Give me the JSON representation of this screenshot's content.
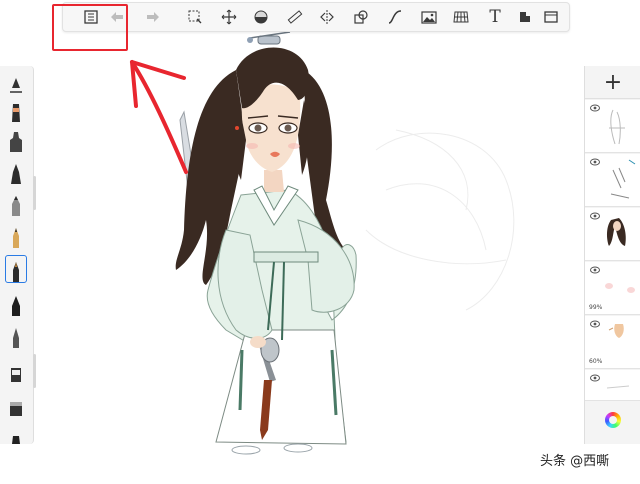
{
  "toolbar": {
    "tools": [
      {
        "name": "gallery-icon"
      },
      {
        "name": "undo-icon"
      },
      {
        "name": "redo-icon"
      },
      {
        "name": "selection-icon"
      },
      {
        "name": "transform-icon"
      },
      {
        "name": "fill-icon"
      },
      {
        "name": "ruler-icon"
      },
      {
        "name": "symmetry-icon"
      },
      {
        "name": "shapes-icon"
      },
      {
        "name": "stroke-icon"
      },
      {
        "name": "import-image-icon"
      },
      {
        "name": "perspective-icon"
      },
      {
        "name": "text-icon",
        "glyph": "T"
      },
      {
        "name": "flipbook-icon"
      },
      {
        "name": "fullscreen-icon"
      }
    ]
  },
  "brushes": [
    {
      "name": "brush-settings-icon"
    },
    {
      "name": "airbrush-icon"
    },
    {
      "name": "marker-icon"
    },
    {
      "name": "brush-pen-icon"
    },
    {
      "name": "pencil-icon"
    },
    {
      "name": "fountain-pen-icon"
    },
    {
      "name": "ink-pen-icon",
      "selected": true
    },
    {
      "name": "ballpoint-icon"
    },
    {
      "name": "fineliner-icon"
    },
    {
      "name": "paint-brush-icon"
    },
    {
      "name": "eraser-icon"
    },
    {
      "name": "blender-icon"
    }
  ],
  "layers": {
    "add_label": "+",
    "items": [
      {
        "name": "layer-sketch",
        "opacity": ""
      },
      {
        "name": "layer-lines",
        "opacity": ""
      },
      {
        "name": "layer-hair",
        "opacity": ""
      },
      {
        "name": "layer-blush",
        "opacity": "99%"
      },
      {
        "name": "layer-skin",
        "opacity": "60%"
      },
      {
        "name": "layer-base",
        "opacity": ""
      }
    ]
  },
  "watermark": "头条 @西嘶",
  "colors": {
    "annotation": "#e8262f",
    "selection_outline": "#2a7be4",
    "robe": "#e6f2ea",
    "hair": "#3a2a22"
  }
}
